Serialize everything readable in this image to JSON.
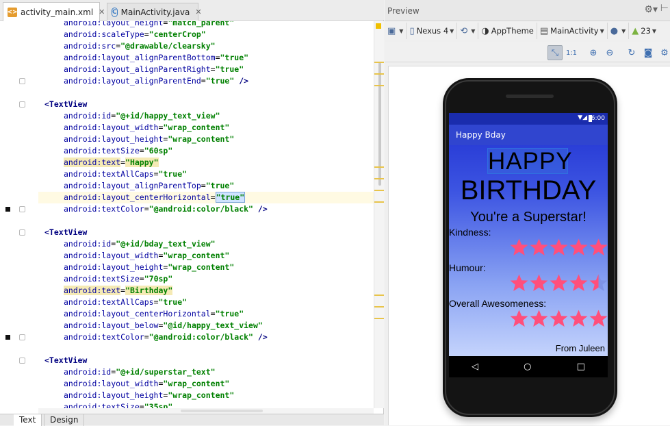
{
  "editor": {
    "tabs": [
      {
        "label": "activity_main.xml",
        "active": true,
        "icon": "xml-file-icon"
      },
      {
        "label": "MainActivity.java",
        "active": false,
        "icon": "java-class-icon"
      }
    ],
    "lines": [
      {
        "kind": "attr",
        "name": "android:layout_height",
        "value": "\"match_parent\"",
        "suffix": ""
      },
      {
        "kind": "attr",
        "name": "android:scaleType",
        "value": "\"centerCrop\"",
        "suffix": ""
      },
      {
        "kind": "attr",
        "name": "android:src",
        "value": "\"@drawable/clearsky\"",
        "suffix": ""
      },
      {
        "kind": "attr",
        "name": "android:layout_alignParentBottom",
        "value": "\"true\"",
        "suffix": ""
      },
      {
        "kind": "attr",
        "name": "android:layout_alignParentRight",
        "value": "\"true\"",
        "suffix": ""
      },
      {
        "kind": "attr",
        "name": "android:layout_alignParentEnd",
        "value": "\"true\"",
        "suffix": " />"
      },
      {
        "kind": "blank"
      },
      {
        "kind": "tag",
        "text": "<TextView"
      },
      {
        "kind": "attr",
        "name": "android:id",
        "value": "\"@+id/happy_text_view\"",
        "suffix": ""
      },
      {
        "kind": "attr",
        "name": "android:layout_width",
        "value": "\"wrap_content\"",
        "suffix": ""
      },
      {
        "kind": "attr",
        "name": "android:layout_height",
        "value": "\"wrap_content\"",
        "suffix": ""
      },
      {
        "kind": "attr",
        "name": "android:textSize",
        "value": "\"60sp\"",
        "suffix": ""
      },
      {
        "kind": "attr",
        "name": "android:text",
        "value": "\"Happy\"",
        "suffix": "",
        "highlight": true
      },
      {
        "kind": "attr",
        "name": "android:textAllCaps",
        "value": "\"true\"",
        "suffix": ""
      },
      {
        "kind": "attr",
        "name": "android:layout_alignParentTop",
        "value": "\"true\"",
        "suffix": ""
      },
      {
        "kind": "attr",
        "name": "android:layout_centerHorizontal",
        "value": "\"true\"",
        "suffix": "",
        "current": true
      },
      {
        "kind": "attr",
        "name": "android:textColor",
        "value": "\"@android:color/black\"",
        "suffix": " />"
      },
      {
        "kind": "blank"
      },
      {
        "kind": "tag",
        "text": "<TextView"
      },
      {
        "kind": "attr",
        "name": "android:id",
        "value": "\"@+id/bday_text_view\"",
        "suffix": ""
      },
      {
        "kind": "attr",
        "name": "android:layout_width",
        "value": "\"wrap_content\"",
        "suffix": ""
      },
      {
        "kind": "attr",
        "name": "android:layout_height",
        "value": "\"wrap_content\"",
        "suffix": ""
      },
      {
        "kind": "attr",
        "name": "android:textSize",
        "value": "\"70sp\"",
        "suffix": ""
      },
      {
        "kind": "attr",
        "name": "android:text",
        "value": "\"Birthday\"",
        "suffix": "",
        "highlight": true
      },
      {
        "kind": "attr",
        "name": "android:textAllCaps",
        "value": "\"true\"",
        "suffix": ""
      },
      {
        "kind": "attr",
        "name": "android:layout_centerHorizontal",
        "value": "\"true\"",
        "suffix": ""
      },
      {
        "kind": "attr",
        "name": "android:layout_below",
        "value": "\"@id/happy_text_view\"",
        "suffix": ""
      },
      {
        "kind": "attr",
        "name": "android:textColor",
        "value": "\"@android:color/black\"",
        "suffix": " />"
      },
      {
        "kind": "blank"
      },
      {
        "kind": "tag",
        "text": "<TextView"
      },
      {
        "kind": "attr",
        "name": "android:id",
        "value": "\"@+id/superstar_text\"",
        "suffix": ""
      },
      {
        "kind": "attr",
        "name": "android:layout_width",
        "value": "\"wrap_content\"",
        "suffix": ""
      },
      {
        "kind": "attr",
        "name": "android:layout_height",
        "value": "\"wrap_content\"",
        "suffix": ""
      },
      {
        "kind": "attr",
        "name": "android:textSize",
        "value": "\"35sp\"",
        "suffix": ""
      }
    ],
    "bottom_tabs": [
      {
        "label": "Text",
        "active": true
      },
      {
        "label": "Design",
        "active": false
      }
    ]
  },
  "preview": {
    "title": "Preview",
    "toolbar": {
      "device": "Nexus 4",
      "theme": "AppTheme",
      "activity": "MainActivity",
      "api": "23"
    },
    "phone": {
      "time": "6:00",
      "app_title": "Happy Bday",
      "happy": "HAPPY",
      "birthday": "BIRTHDAY",
      "superstar": "You're a Superstar!",
      "ratings": [
        {
          "label": "Kindness:",
          "value": 5
        },
        {
          "label": "Humour:",
          "value": 4.5
        },
        {
          "label": "Overall Awesomeness:",
          "value": 5
        }
      ],
      "from": "From Juleen",
      "star_color": "#ff4f7b",
      "nav": [
        "◁",
        "○",
        "□"
      ]
    }
  }
}
